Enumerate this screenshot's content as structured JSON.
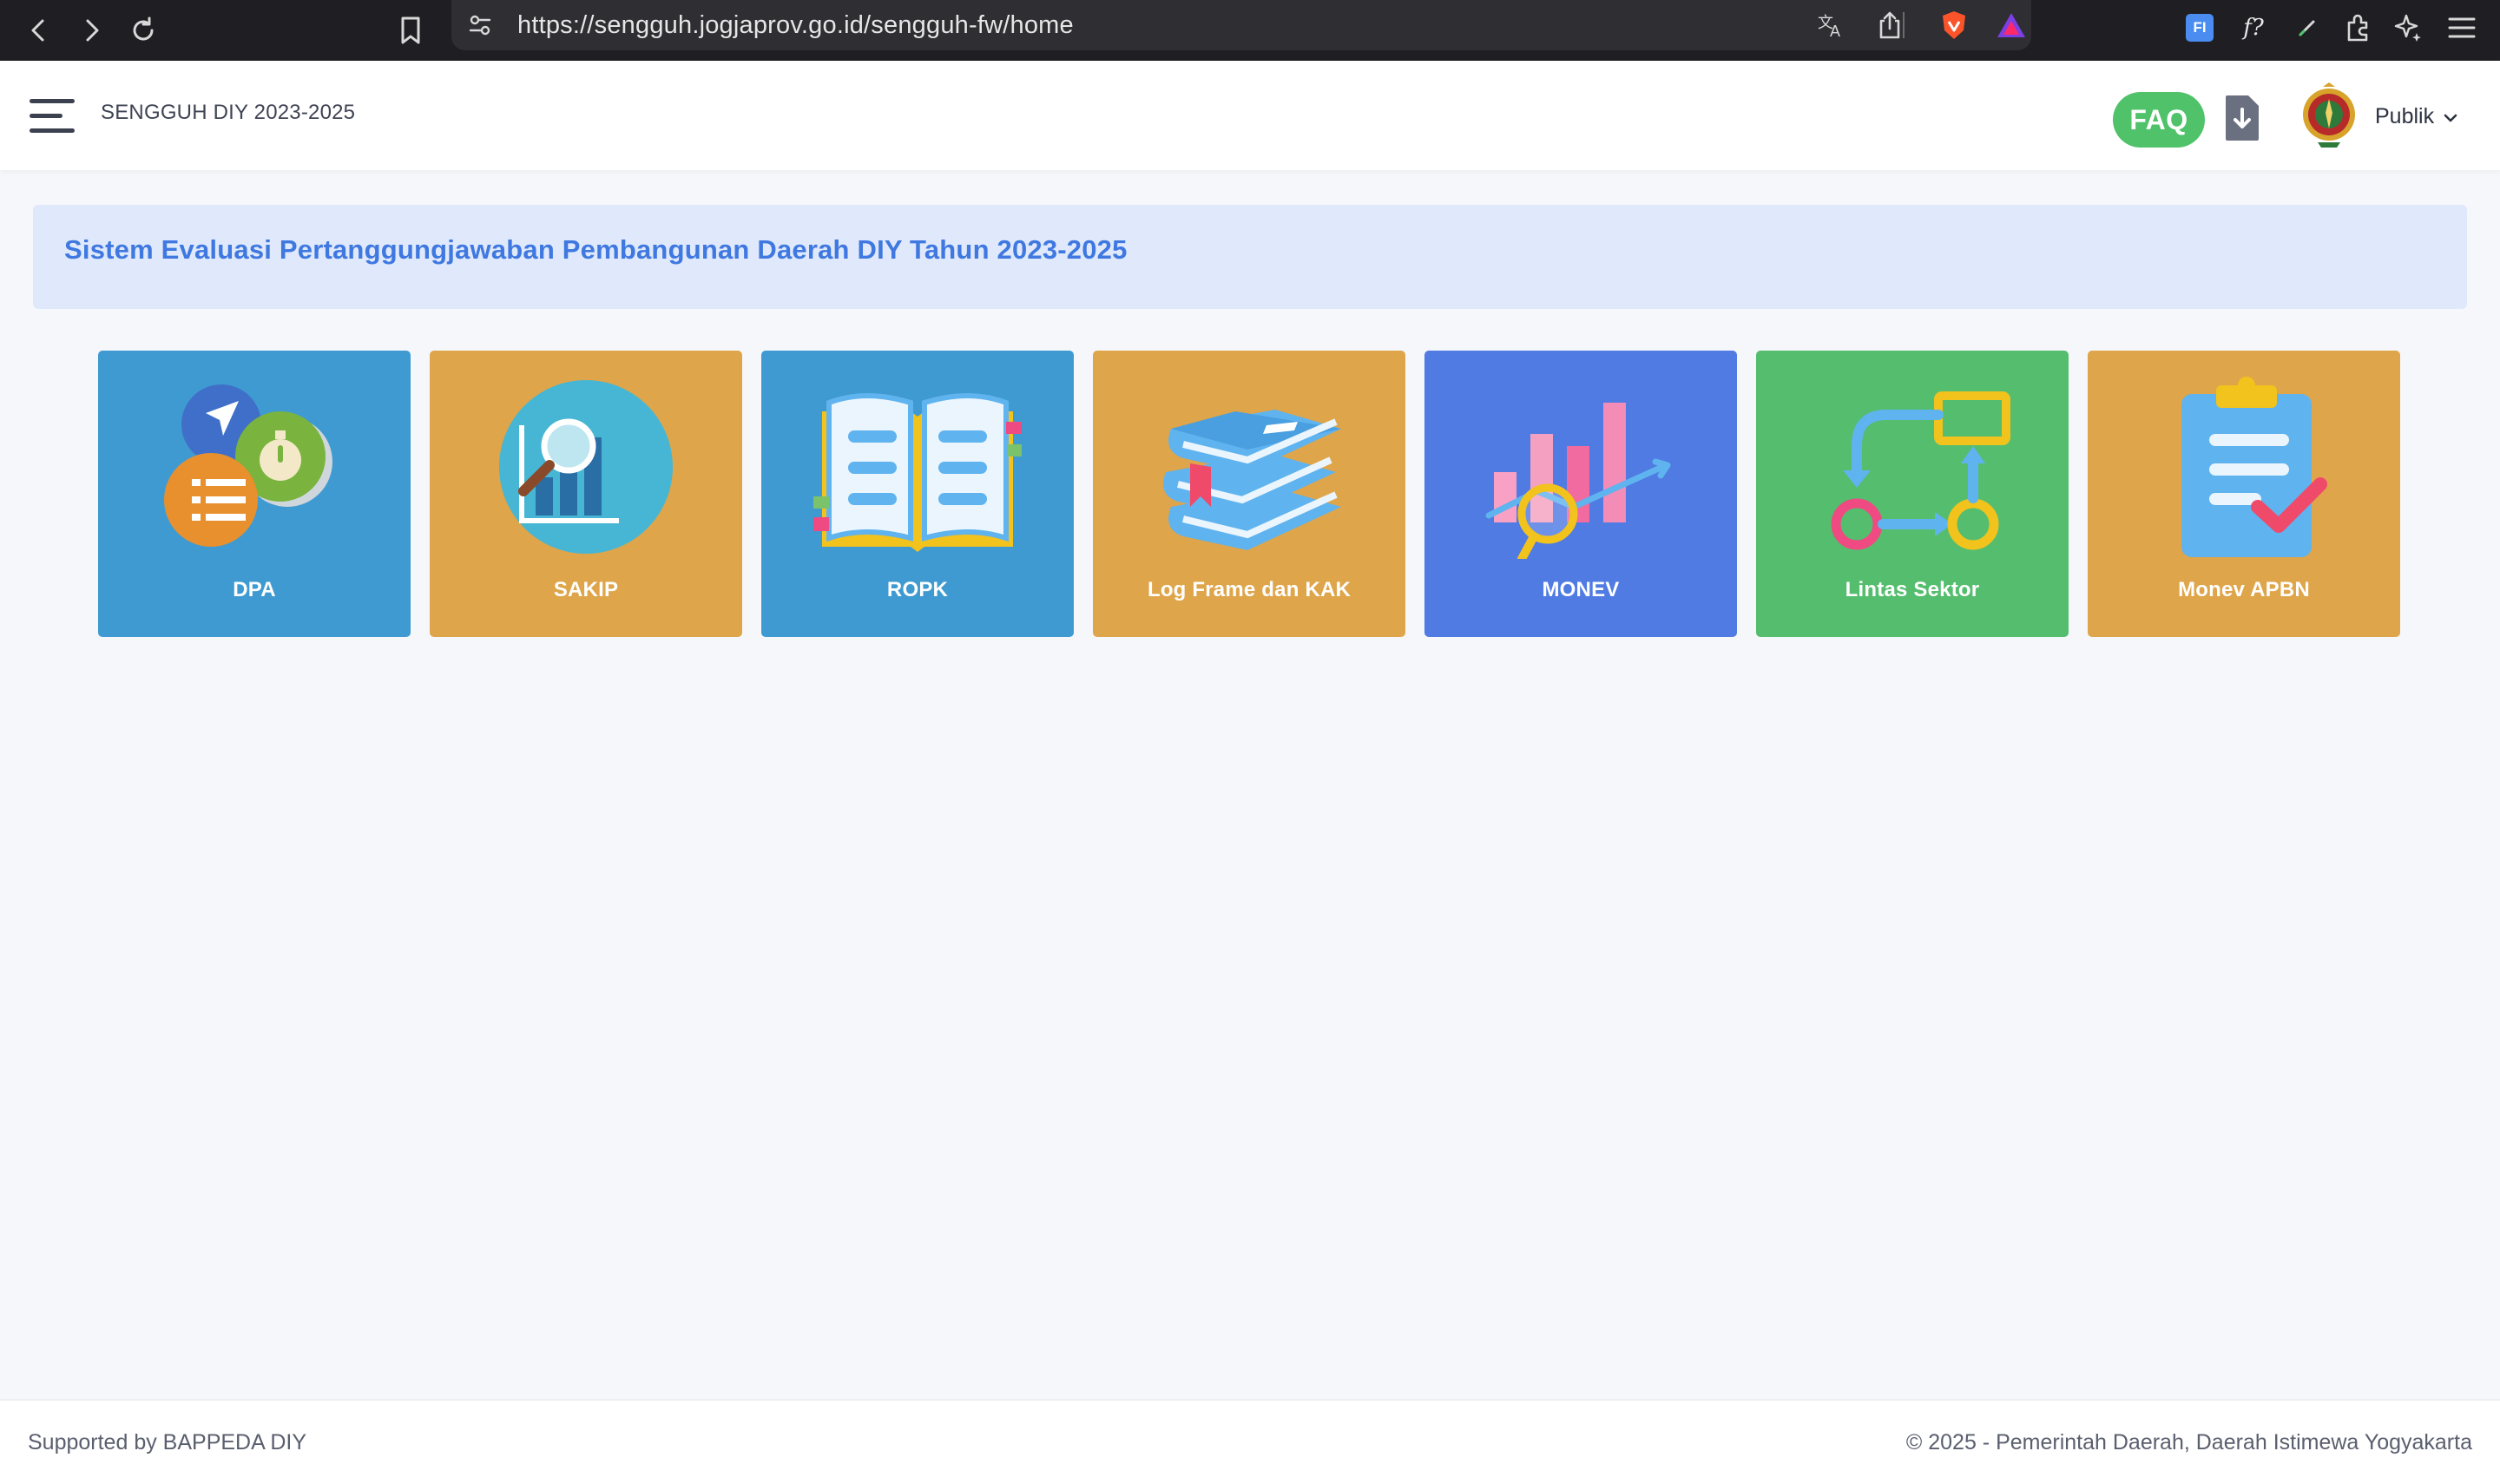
{
  "browser": {
    "url": "https://sengguh.jogjaprov.go.id/sengguh-fw/home",
    "icons": [
      "back-icon",
      "forward-icon",
      "reload-icon",
      "bookmark-icon",
      "site-settings-icon",
      "translate-icon",
      "share-icon",
      "brave-shield-icon",
      "brave-rewards-icon",
      "ext-fi-icon",
      "ext-f-formula-icon",
      "ext-pen-icon",
      "extensions-icon",
      "leo-ai-icon",
      "browser-menu-icon"
    ],
    "ext_fi_label": "FI",
    "ext_f_label": "f?"
  },
  "header": {
    "title": "SENGGUH DIY 2023-2025",
    "faq_label": "FAQ",
    "user_label": "Publik",
    "colors": {
      "faq_bg": "#4fc26a"
    }
  },
  "banner": {
    "text": "Sistem Evaluasi Pertanggungjawaban Pembangunan Daerah DIY Tahun 2023-2025"
  },
  "tiles": [
    {
      "label": "DPA",
      "color": "#3f9ad1",
      "icon": "dpa-icon"
    },
    {
      "label": "SAKIP",
      "color": "#dfa54a",
      "icon": "sakip-icon"
    },
    {
      "label": "ROPK",
      "color": "#3f9ad1",
      "icon": "ropk-icon"
    },
    {
      "label": "Log Frame dan KAK",
      "color": "#dfa54a",
      "icon": "log-frame-icon"
    },
    {
      "label": "MONEV",
      "color": "#4f7be3",
      "icon": "monev-icon"
    },
    {
      "label": "Lintas Sektor",
      "color": "#55bd6e",
      "icon": "lintas-sektor-icon"
    },
    {
      "label": "Monev APBN",
      "color": "#dfa54a",
      "icon": "monev-apbn-icon"
    }
  ],
  "footer": {
    "left": "Supported by BAPPEDA DIY",
    "right": "© 2025 - Pemerintah Daerah, Daerah Istimewa Yogyakarta"
  }
}
